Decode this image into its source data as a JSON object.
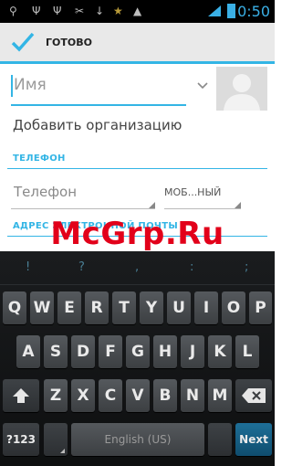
{
  "status_bar": {
    "time": "0:50",
    "icons": [
      "usb-icon",
      "usb-icon",
      "usb-icon",
      "usb-debug-icon",
      "sync-icon",
      "star-icon",
      "warning-icon",
      "signal-icon",
      "battery-icon"
    ]
  },
  "action_bar": {
    "done_label": "ГОТОВО",
    "accent": "#33b5e5"
  },
  "form": {
    "name_placeholder": "Имя",
    "add_org": "Добавить организацию",
    "phone_section": "ТЕЛЕФОН",
    "phone_placeholder": "Телефон",
    "phone_type": "МОБ...НЫЙ",
    "email_section": "АДРЕС ЭЛЕКТРОННОЙ ПОЧТЫ"
  },
  "watermark": "McGrp.Ru",
  "keyboard": {
    "hints": [
      "!",
      "?",
      ",",
      ":",
      ";",
      "/",
      "'"
    ],
    "row1": [
      "Q",
      "W",
      "E",
      "R",
      "T",
      "Y",
      "U",
      "I",
      "O",
      "P"
    ],
    "row2": [
      "A",
      "S",
      "D",
      "F",
      "G",
      "H",
      "J",
      "K",
      "L"
    ],
    "row3": [
      "Z",
      "X",
      "C",
      "V",
      "B",
      "N",
      "M"
    ],
    "sym_label": "?123",
    "space_label": "English (US)",
    "next_label": "Next"
  }
}
